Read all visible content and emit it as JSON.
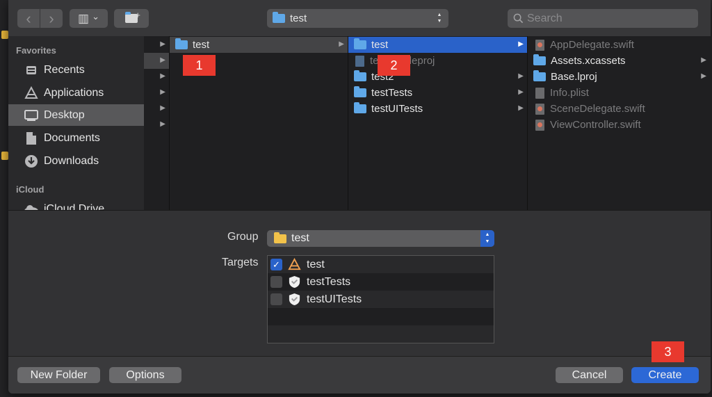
{
  "toolbar": {
    "back_glyph": "‹",
    "forward_glyph": "›",
    "view_glyph": "▥",
    "view_chevron": "⌄",
    "new_folder_glyph": "+",
    "path_label": "test",
    "path_chevron_up": "▲",
    "path_chevron_down": "▼",
    "search_placeholder": "Search"
  },
  "sidebar": {
    "favorites_label": "Favorites",
    "icloud_label": "iCloud",
    "items": [
      {
        "label": "Recents",
        "icon": "clock-icon"
      },
      {
        "label": "Applications",
        "icon": "applications-icon"
      },
      {
        "label": "Desktop",
        "icon": "desktop-icon"
      },
      {
        "label": "Documents",
        "icon": "document-icon"
      },
      {
        "label": "Downloads",
        "icon": "download-icon"
      }
    ],
    "icloud_items": [
      {
        "label": "iCloud Drive",
        "icon": "cloud-icon"
      }
    ]
  },
  "columns": {
    "col1": [
      {
        "label": "test"
      }
    ],
    "col2": [
      {
        "label": "test"
      },
      {
        "label": "test.xcodeproj"
      },
      {
        "label": "test2"
      },
      {
        "label": "testTests"
      },
      {
        "label": "testUITests"
      }
    ],
    "col3": [
      {
        "label": "AppDelegate.swift"
      },
      {
        "label": "Assets.xcassets"
      },
      {
        "label": "Base.lproj"
      },
      {
        "label": "Info.plist"
      },
      {
        "label": "SceneDelegate.swift"
      },
      {
        "label": "ViewController.swift"
      }
    ]
  },
  "badges": [
    "1",
    "2",
    "3"
  ],
  "options": {
    "group_label": "Group",
    "group_value": "test",
    "targets_label": "Targets",
    "targets": [
      {
        "label": "test",
        "checked": true
      },
      {
        "label": "testTests",
        "checked": false
      },
      {
        "label": "testUITests",
        "checked": false
      }
    ],
    "check_glyph": "✓"
  },
  "buttons": {
    "new_folder": "New Folder",
    "options": "Options",
    "cancel": "Cancel",
    "create": "Create"
  },
  "colors": {
    "accent": "#2a62c9",
    "badge": "#e8392e",
    "folder": "#5fa8e8"
  }
}
